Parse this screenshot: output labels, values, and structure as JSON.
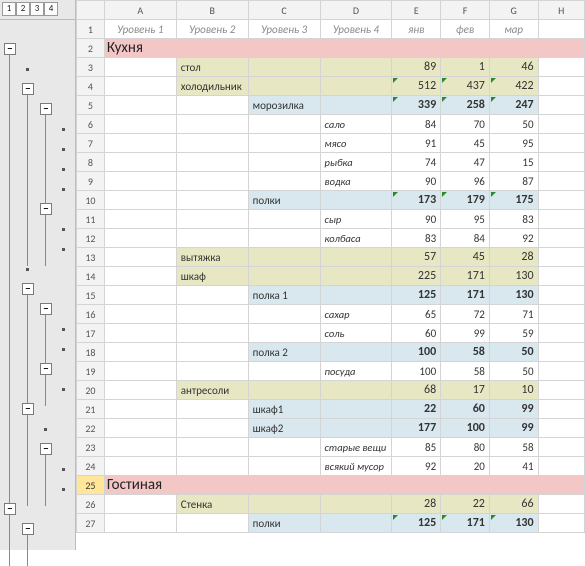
{
  "outline_levels": [
    "1",
    "2",
    "3",
    "4"
  ],
  "col_letters": [
    "A",
    "B",
    "C",
    "D",
    "E",
    "F",
    "G",
    "H"
  ],
  "headers": {
    "A": "Уровень 1",
    "B": "Уровень 2",
    "C": "Уровень 3",
    "D": "Уровень 4",
    "E": "янв",
    "F": "фев",
    "G": "мар"
  },
  "rows": [
    {
      "n": "2",
      "type": "l1",
      "label": "Кухня"
    },
    {
      "n": "3",
      "type": "l2",
      "label": "стол",
      "e": "89",
      "f": "1",
      "g": "46"
    },
    {
      "n": "4",
      "type": "l2",
      "label": "холодильник",
      "e": "512",
      "f": "437",
      "g": "422",
      "tri": true
    },
    {
      "n": "5",
      "type": "l3",
      "label": "морозилка",
      "e": "339",
      "f": "258",
      "g": "247",
      "bold": true,
      "tri": true
    },
    {
      "n": "6",
      "type": "l4",
      "label": "сало",
      "e": "84",
      "f": "70",
      "g": "50"
    },
    {
      "n": "7",
      "type": "l4",
      "label": "мясо",
      "e": "91",
      "f": "45",
      "g": "95"
    },
    {
      "n": "8",
      "type": "l4",
      "label": "рыбка",
      "e": "74",
      "f": "47",
      "g": "15"
    },
    {
      "n": "9",
      "type": "l4",
      "label": "водка",
      "e": "90",
      "f": "96",
      "g": "87"
    },
    {
      "n": "10",
      "type": "l3",
      "label": "полки",
      "e": "173",
      "f": "179",
      "g": "175",
      "bold": true,
      "tri": true
    },
    {
      "n": "11",
      "type": "l4",
      "label": "сыр",
      "e": "90",
      "f": "95",
      "g": "83"
    },
    {
      "n": "12",
      "type": "l4",
      "label": "колбаса",
      "e": "83",
      "f": "84",
      "g": "92"
    },
    {
      "n": "13",
      "type": "l2",
      "label": "вытяжка",
      "e": "57",
      "f": "45",
      "g": "28"
    },
    {
      "n": "14",
      "type": "l2",
      "label": "шкаф",
      "e": "225",
      "f": "171",
      "g": "130"
    },
    {
      "n": "15",
      "type": "l3",
      "label": "полка 1",
      "e": "125",
      "f": "171",
      "g": "130",
      "bold": true
    },
    {
      "n": "16",
      "type": "l4",
      "label": "сахар",
      "e": "65",
      "f": "72",
      "g": "71"
    },
    {
      "n": "17",
      "type": "l4",
      "label": "соль",
      "e": "60",
      "f": "99",
      "g": "59"
    },
    {
      "n": "18",
      "type": "l3",
      "label": "полка 2",
      "e": "100",
      "f": "58",
      "g": "50",
      "bold": true
    },
    {
      "n": "19",
      "type": "l4",
      "label": "посуда",
      "e": "100",
      "f": "58",
      "g": "50"
    },
    {
      "n": "20",
      "type": "l2",
      "label": "антресоли",
      "e": "68",
      "f": "17",
      "g": "10"
    },
    {
      "n": "21",
      "type": "l3",
      "label": "шкаф1",
      "e": "22",
      "f": "60",
      "g": "99",
      "bold": true
    },
    {
      "n": "22",
      "type": "l3",
      "label": "шкаф2",
      "e": "177",
      "f": "100",
      "g": "99",
      "bold": true
    },
    {
      "n": "23",
      "type": "l4",
      "label": "старые вещи",
      "e": "85",
      "f": "80",
      "g": "58"
    },
    {
      "n": "24",
      "type": "l4",
      "label": "всякий мусор",
      "e": "92",
      "f": "20",
      "g": "41"
    },
    {
      "n": "25",
      "type": "l1",
      "label": "Гостиная",
      "sel": true
    },
    {
      "n": "26",
      "type": "l2",
      "label": "Стенка",
      "e": "28",
      "f": "22",
      "g": "66"
    },
    {
      "n": "27",
      "type": "l3",
      "label": "полки",
      "e": "125",
      "f": "171",
      "g": "130",
      "bold": true,
      "tri": true
    }
  ],
  "outline_buttons": [
    {
      "col": 0,
      "row": 2,
      "sym": "−"
    },
    {
      "col": 1,
      "row": 4,
      "sym": "−"
    },
    {
      "col": 2,
      "row": 5,
      "sym": "−"
    },
    {
      "col": 2,
      "row": 10,
      "sym": "−"
    },
    {
      "col": 1,
      "row": 14,
      "sym": "−"
    },
    {
      "col": 2,
      "row": 15,
      "sym": "−"
    },
    {
      "col": 2,
      "row": 18,
      "sym": "−"
    },
    {
      "col": 1,
      "row": 20,
      "sym": "−"
    },
    {
      "col": 2,
      "row": 22,
      "sym": "−"
    },
    {
      "col": 0,
      "row": 25,
      "sym": "−"
    },
    {
      "col": 1,
      "row": 26,
      "sym": "−"
    }
  ],
  "outline_lines": [
    {
      "col": 0,
      "from": 2,
      "to": 25
    },
    {
      "col": 1,
      "from": 4,
      "to": 13
    },
    {
      "col": 2,
      "from": 5,
      "to": 10
    },
    {
      "col": 2,
      "from": 10,
      "to": 13
    },
    {
      "col": 1,
      "from": 14,
      "to": 20
    },
    {
      "col": 2,
      "from": 15,
      "to": 18
    },
    {
      "col": 2,
      "from": 18,
      "to": 20
    },
    {
      "col": 1,
      "from": 20,
      "to": 25
    },
    {
      "col": 2,
      "from": 22,
      "to": 25
    },
    {
      "col": 0,
      "from": 25,
      "to": 28
    },
    {
      "col": 1,
      "from": 26,
      "to": 28
    }
  ],
  "outline_dots": [
    {
      "col": 1,
      "row": 3
    },
    {
      "col": 3,
      "row": 6
    },
    {
      "col": 3,
      "row": 7
    },
    {
      "col": 3,
      "row": 8
    },
    {
      "col": 3,
      "row": 9
    },
    {
      "col": 3,
      "row": 11
    },
    {
      "col": 3,
      "row": 12
    },
    {
      "col": 1,
      "row": 13
    },
    {
      "col": 3,
      "row": 16
    },
    {
      "col": 3,
      "row": 17
    },
    {
      "col": 3,
      "row": 19
    },
    {
      "col": 2,
      "row": 21
    },
    {
      "col": 3,
      "row": 23
    },
    {
      "col": 3,
      "row": 24
    }
  ]
}
